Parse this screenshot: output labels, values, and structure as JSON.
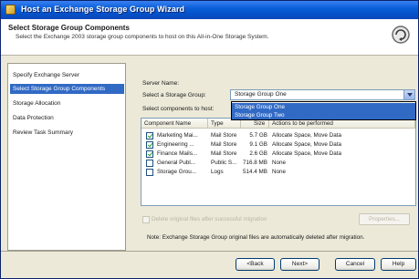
{
  "window": {
    "title": "Host an Exchange Storage Group Wizard"
  },
  "header": {
    "title": "Select Storage Group Components",
    "subtitle": "Select the Exchange 2003 storage group components to host on this All-in-One Storage System."
  },
  "nav": {
    "items": [
      {
        "label": "Specify Exchange Server",
        "selected": false
      },
      {
        "label": "Select Storage Group Components",
        "selected": true
      },
      {
        "label": "Storage Allocation",
        "selected": false
      },
      {
        "label": "Data Protection",
        "selected": false
      },
      {
        "label": "Review Task Summary",
        "selected": false
      }
    ]
  },
  "main": {
    "server_name_label": "Server Name:",
    "storage_group_label": "Select a Storage Group:",
    "storage_group_value": "Storage Group One",
    "storage_group_options": [
      "Storage Group One",
      "Storage Group Two"
    ],
    "components_label": "Select components to host:",
    "columns": [
      "Component Name",
      "Type",
      "Size",
      "Actions to be performed"
    ],
    "rows": [
      {
        "checked": true,
        "name": "Marketing Mai...",
        "type": "Mail Store",
        "size": "5.7 GB",
        "actions": "Allocate Space, Move Data"
      },
      {
        "checked": true,
        "name": "Engineering ...",
        "type": "Mail Store",
        "size": "9.1 GB",
        "actions": "Allocate Space, Move Data"
      },
      {
        "checked": true,
        "name": "Finance Mails...",
        "type": "Mail Store",
        "size": "2.6 GB",
        "actions": "Allocate Space, Move Data"
      },
      {
        "checked": false,
        "name": "General Publ...",
        "type": "Public S...",
        "size": "716.8 MB",
        "actions": "None"
      },
      {
        "checked": false,
        "name": "Storage Grou...",
        "type": "Logs",
        "size": "514.4 MB",
        "actions": "None"
      }
    ],
    "delete_checkbox_label": "Delete original files after successful migration",
    "properties_button": "Properties...",
    "note": "Note: Exchange Storage Group original files are automatically deleted after migration."
  },
  "footer": {
    "back": "<Back",
    "next": "Next>",
    "cancel": "Cancel",
    "help": "Help"
  },
  "colors": {
    "accent": "#316ac5",
    "titlebar": "#0a5fd8",
    "checkmark": "#21a121"
  }
}
